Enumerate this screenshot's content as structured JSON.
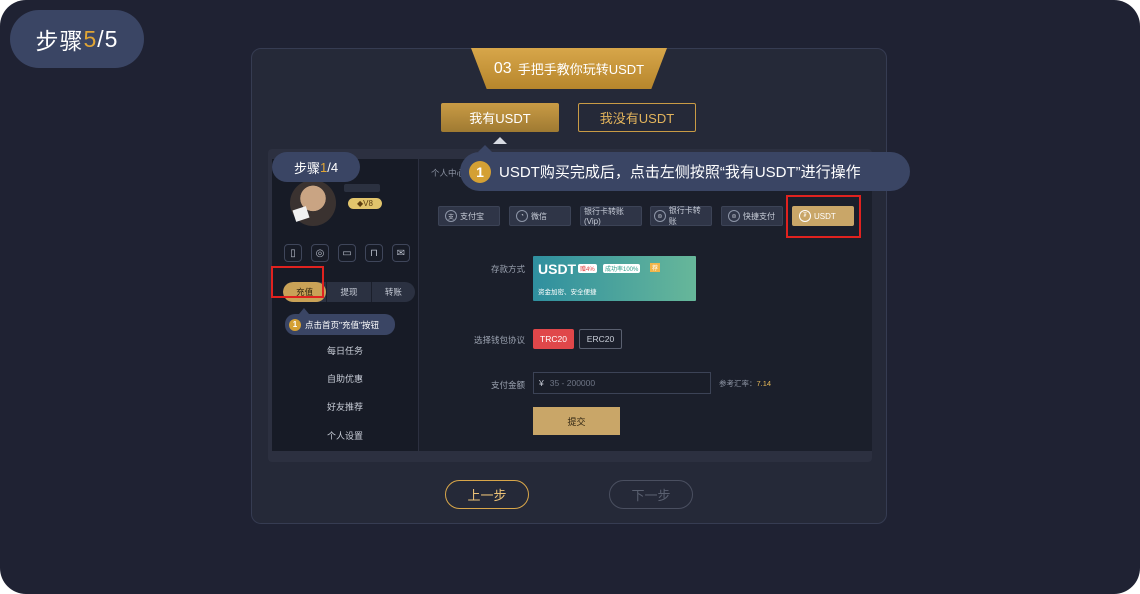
{
  "step_indicator": {
    "prefix": "步骤",
    "current": "5",
    "total": "/5"
  },
  "title_tab": {
    "number": "03",
    "text": "手把手教你玩转USDT"
  },
  "toggle": {
    "have_label": "我有USDT",
    "not_have_label": "我没有USDT"
  },
  "inner": {
    "step_indicator": {
      "prefix": "步骤",
      "current": "1",
      "total": "/4"
    },
    "vip_badge": "V8",
    "icons": [
      "phone-icon",
      "user-icon",
      "wallet-icon",
      "lock-icon",
      "mail-icon"
    ],
    "segments": [
      "充值",
      "提现",
      "转账"
    ],
    "callout_small": {
      "num": "1",
      "text": "点击首页\"充值\"按钮"
    },
    "menu": [
      "每日任务",
      "自助优惠",
      "好友推荐",
      "个人设置"
    ],
    "breadcrumb": "个人中心",
    "payment_methods": [
      "支付宝",
      "微信",
      "银行卡转账(Vip)",
      "银行卡转账",
      "快捷支付",
      "USDT"
    ],
    "deposit_label": "存款方式",
    "usdt_card": {
      "title": "USDT",
      "tag1": "赠4%",
      "tag2": "成功率100%",
      "tag3": "荐",
      "subtitle": "资金加密、安全便捷"
    },
    "protocol_label": "选择钱包协议",
    "protocols": [
      "TRC20",
      "ERC20"
    ],
    "amount_label": "支付金额",
    "amount_currency": "¥",
    "amount_placeholder": "35 - 200000",
    "rate_label": "参考汇率：",
    "rate_value": "7.14",
    "submit_label": "提交"
  },
  "callout_big": {
    "num": "1",
    "text": "USDT购买完成后，点击左侧按照“我有USDT”进行操作"
  },
  "nav": {
    "prev_label": "上一步",
    "next_label": "下一步"
  },
  "colors": {
    "accent": "#d4a034",
    "background": "#1f2233",
    "callout": "#3a4564",
    "highlight_border": "#e0221f"
  }
}
